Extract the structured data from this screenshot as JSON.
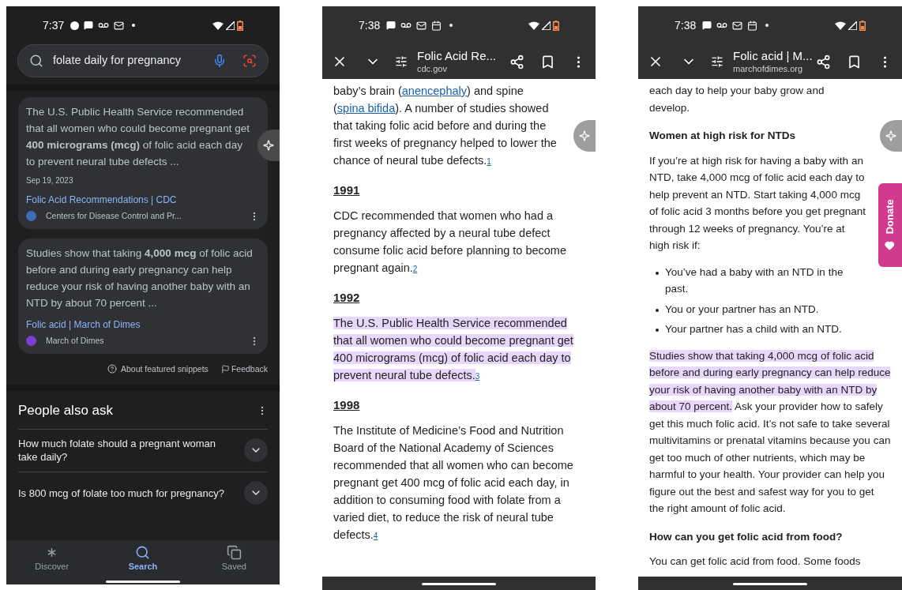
{
  "search_results": {
    "status": {
      "time": "7:37"
    },
    "search": {
      "value": "folate daily for pregnancy"
    },
    "snippets": [
      {
        "text": "The U.S. Public Health Service recommended that all women who could become pregnant get **400 micrograms (mcg)** of folic acid each day to prevent neural tube defects ...",
        "date": "Sep 19, 2023",
        "title": "Folic Acid Recommendations | CDC",
        "source": "Centers for Disease Control and Pr..."
      },
      {
        "text": "Studies show that taking **4,000 mcg** of folic acid before and during early pregnancy can help reduce your risk of having another baby with an NTD by about 70 percent ...",
        "title": "Folic acid | March of Dimes",
        "source": "March of Dimes"
      }
    ],
    "snippet_links": [
      "About featured snippets",
      "Feedback"
    ],
    "people_also_ask": {
      "title": "People also ask",
      "questions": [
        {
          "text": "How much folate should a pregnant woman take daily?",
          "expanded": false
        },
        {
          "text": "Is 800 mcg of folate too much for pregnancy?",
          "expanded": false
        }
      ]
    },
    "nav": [
      {
        "label": "Discover",
        "selected": false
      },
      {
        "label": "Search",
        "selected": true
      },
      {
        "label": "Saved",
        "selected": false
      }
    ]
  },
  "cdc_page": {
    "status": {
      "time": "7:38"
    },
    "toolbar": {
      "title": "Folic Acid Re...",
      "domain": "cdc.gov"
    },
    "blocks": [
      {
        "kind": "paragraph",
        "segments": [
          {
            "kind": "text",
            "text": "baby’s brain ("
          },
          {
            "kind": "link",
            "text": "anencephaly"
          },
          {
            "kind": "text",
            "text": ") and spine ("
          },
          {
            "kind": "link",
            "text": "spina bifida"
          },
          {
            "kind": "text",
            "text": "). A number of studies showed that taking folic acid before and during the first weeks of pregnancy helped to lower the chance of neural tube defects."
          },
          {
            "kind": "footnote",
            "text": "1"
          }
        ]
      },
      {
        "kind": "heading",
        "text": "1991"
      },
      {
        "kind": "paragraph",
        "segments": [
          {
            "kind": "text",
            "text": "CDC recommended that women who had a pregnancy affected by a neural tube defect consume folic acid before planning to become pregnant again."
          },
          {
            "kind": "footnote",
            "text": "2"
          }
        ]
      },
      {
        "kind": "heading",
        "text": "1992"
      },
      {
        "kind": "paragraph",
        "segments": [
          {
            "kind": "highlight",
            "text": "The U.S. Public Health Service recommended that all women who could become pregnant get 400 micrograms (mcg) of folic acid each day to prevent neural tube defects."
          },
          {
            "kind": "footnote",
            "text": "3"
          }
        ]
      },
      {
        "kind": "heading",
        "text": "1998"
      },
      {
        "kind": "paragraph",
        "segments": [
          {
            "kind": "text",
            "text": "The Institute of Medicine’s Food and Nutrition Board of the National Academy of Sciences recommended that all women who can become pregnant get 400 mcg of folic acid each day, in addition to consuming food with folate from a varied diet, to reduce the risk of neural tube defects."
          },
          {
            "kind": "footnote",
            "text": "4"
          }
        ]
      }
    ]
  },
  "march_of_dimes_page": {
    "status": {
      "time": "7:38"
    },
    "toolbar": {
      "title": "Folic acid | M...",
      "domain": "marchofdimes.org"
    },
    "donate": "Donate",
    "blocks": [
      {
        "kind": "paragraph",
        "segments": [
          {
            "kind": "text",
            "text": "each day to help your baby grow and develop."
          }
        ]
      },
      {
        "kind": "heading",
        "text": "Women at high risk for NTDs"
      },
      {
        "kind": "paragraph",
        "segments": [
          {
            "kind": "text",
            "text": "If you’re at high risk for having a baby with an NTD, take 4,000 mcg of folic acid each day to help prevent an NTD. Start taking 4,000 mcg of folic acid 3 months before you get pregnant through 12 weeks of pregnancy. You’re at high risk if:"
          }
        ]
      },
      {
        "kind": "list",
        "items": [
          "You’ve had a baby with an NTD in the past.",
          "You or your partner has an NTD.",
          "Your partner has a child with an NTD."
        ]
      },
      {
        "kind": "paragraph",
        "segments": [
          {
            "kind": "highlight",
            "text": "Studies show that taking 4,000 mcg of folic acid before and during early pregnancy can help reduce your risk of having another baby with an NTD by about 70 percent."
          },
          {
            "kind": "text",
            "text": " Ask your provider how to safely get this much folic acid. It’s not safe to take several multivitamins or prenatal vitamins because you can get too much of other nutrients, which may be harmful to your health. Your provider can help you figure out the best and safest way for you to get the right amount of folic acid."
          }
        ]
      },
      {
        "kind": "heading",
        "text": "How can you get folic acid from food?"
      },
      {
        "kind": "paragraph",
        "segments": [
          {
            "kind": "text",
            "text": "You can get folic acid from food. Some foods"
          }
        ]
      }
    ]
  }
}
